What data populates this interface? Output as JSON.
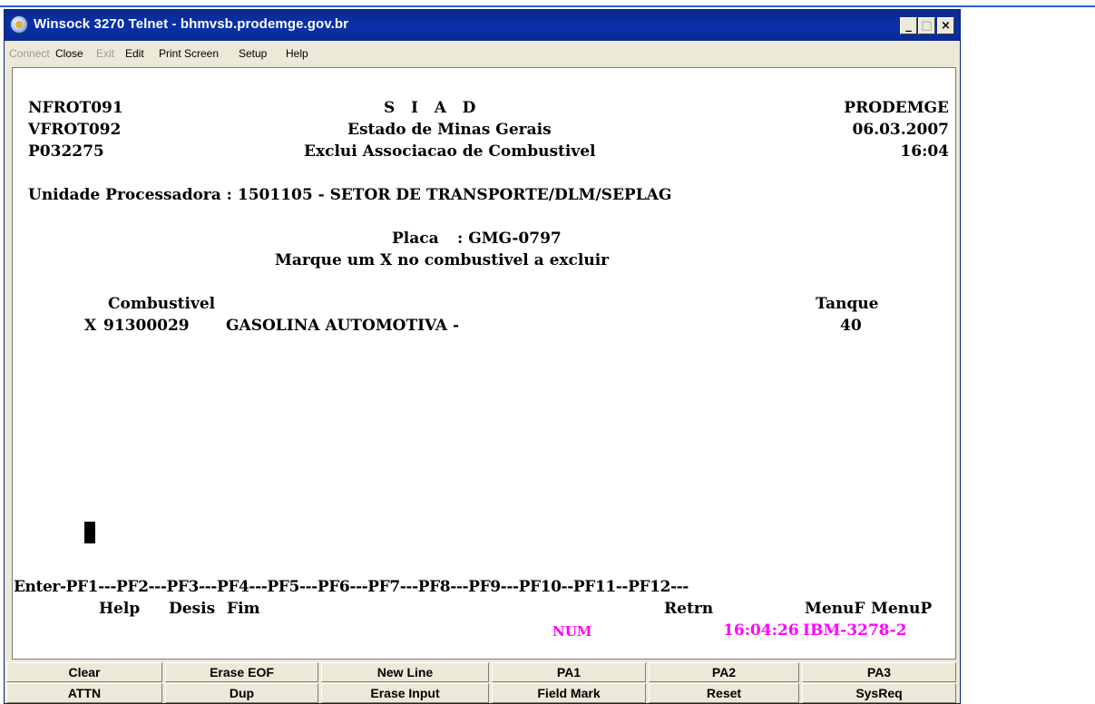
{
  "window": {
    "title": "Winsock 3270 Telnet - bhmvsb.prodemge.gov.br",
    "minimize": "_",
    "maximize": "□",
    "close": "×"
  },
  "menu": [
    "Connect",
    "Close",
    "Exit",
    "Edit",
    "Print Screen",
    "Setup",
    "Help"
  ],
  "screen": {
    "header": {
      "left": [
        "NFROT091",
        "VFROT092",
        "P032275"
      ],
      "center": [
        "S   I   A   D",
        "Estado de Minas Gerais",
        "Exclui Associacao de Combustivel"
      ],
      "right": [
        "PRODEMGE",
        "06.03.2007",
        "16:04"
      ]
    },
    "unidade": "Unidade Processadora : 1501105 - SETOR DE TRANSPORTE/DLM/SEPLAG",
    "placa_label": "Placa",
    "placa_value": ": GMG-0797",
    "instruction": "Marque um X no combustivel a excluir",
    "col_combustivel": "Combustivel",
    "col_tanque": "Tanque",
    "row": {
      "mark": "X",
      "code": "91300029",
      "name": "GASOLINA AUTOMOTIVA -",
      "tanque": "40"
    },
    "pf_line": "Enter-PF1---PF2---PF3---PF4---PF5---PF6---PF7---PF8---PF9---PF10--PF11--PF12---",
    "pf_labels": {
      "help": "Help",
      "desis": "Desis",
      "fim": "Fim",
      "retrn": "Retrn",
      "menuf": "MenuF",
      "menup": "MenuP"
    },
    "status": {
      "num": "NUM",
      "time": "16:04:26",
      "terminal": "IBM-3278-2"
    }
  },
  "keypad": {
    "row1": [
      "Clear",
      "Erase EOF",
      "New Line",
      "PA1",
      "PA2",
      "PA3"
    ],
    "row2": [
      "ATTN",
      "Dup",
      "Erase Input",
      "Field Mark",
      "Reset",
      "SysReq"
    ]
  },
  "colors": {
    "titlebar": "#0a2fa6",
    "status_text": "#ff00ff",
    "chrome": "#ece9d8"
  }
}
